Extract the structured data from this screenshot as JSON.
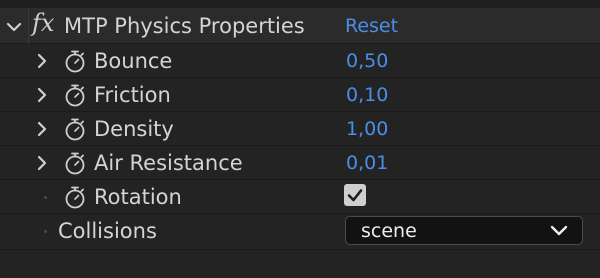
{
  "effect": {
    "name": "MTP Physics Properties",
    "reset_label": "Reset",
    "fx_glyph": "fx"
  },
  "properties": [
    {
      "label": "Bounce",
      "value": "0,50"
    },
    {
      "label": "Friction",
      "value": "0,10"
    },
    {
      "label": "Density",
      "value": "1,00"
    },
    {
      "label": "Air Resistance",
      "value": "0,01"
    }
  ],
  "rotation": {
    "label": "Rotation",
    "checked": true
  },
  "collisions": {
    "label": "Collisions",
    "value": "scene"
  },
  "icons": {
    "expand": "chevron-down-icon",
    "collapse": "chevron-right-icon",
    "stopwatch": "stopwatch-icon",
    "check": "checkmark-icon",
    "dropdown": "chevron-down-icon"
  },
  "colors": {
    "background": "#232323",
    "header_background": "#2b2b2b",
    "value_blue": "#4a8fe7",
    "label": "#d4d4d4"
  }
}
